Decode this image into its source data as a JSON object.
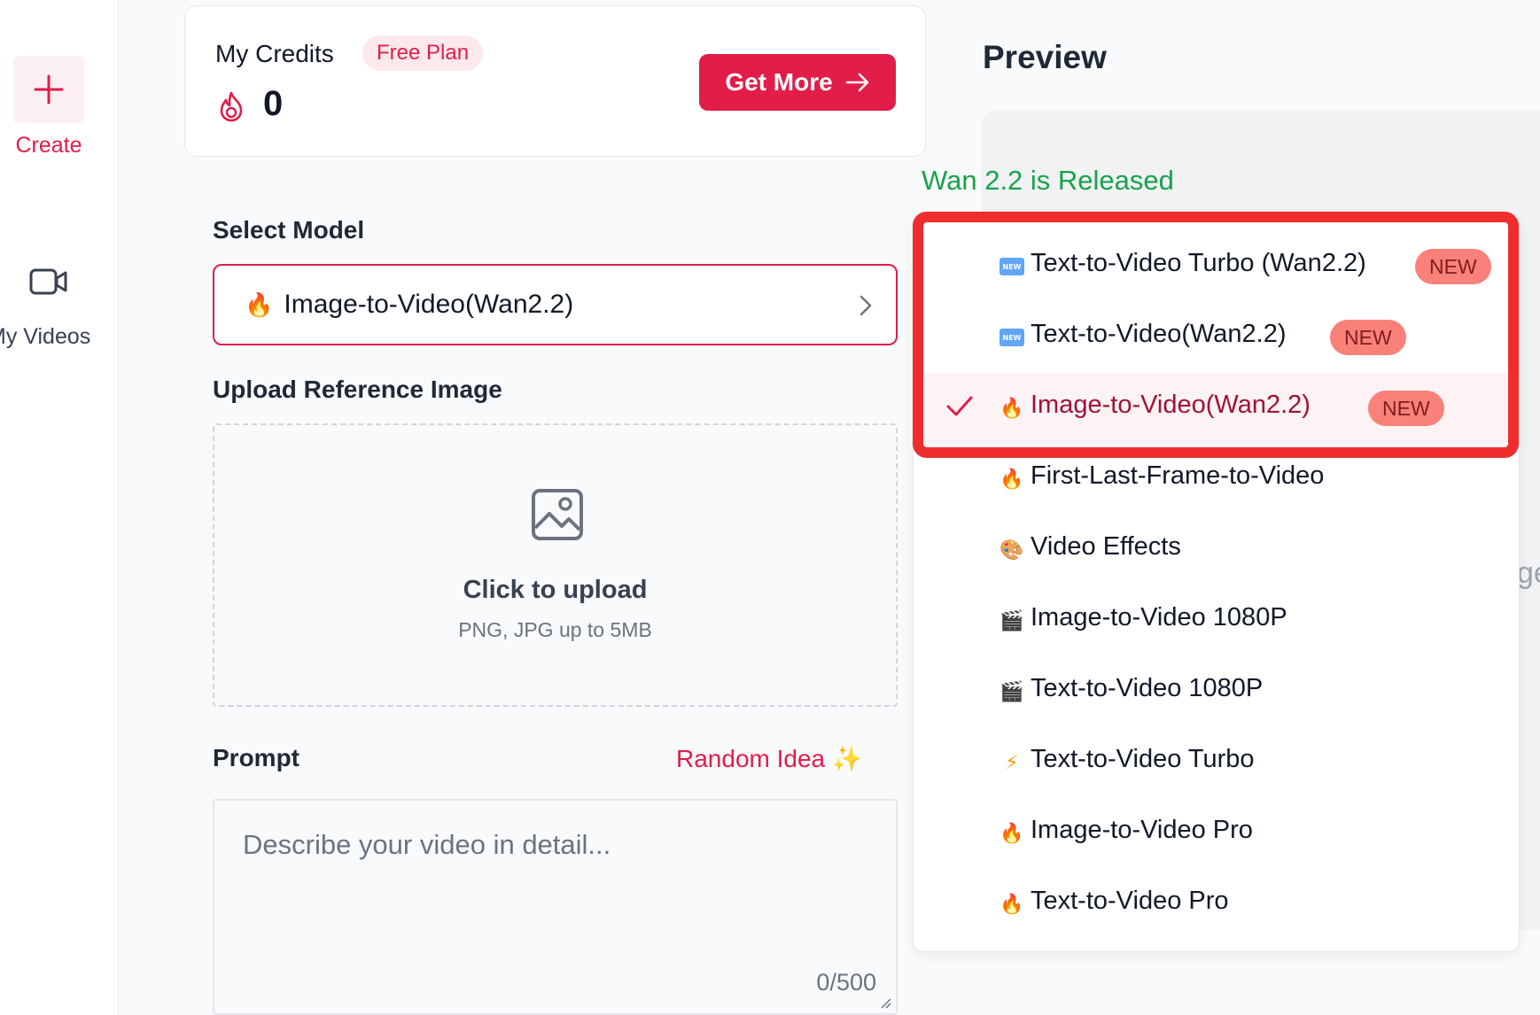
{
  "sidebar": {
    "create_label": "Create",
    "videos_label": "My Videos"
  },
  "credits": {
    "title": "My Credits",
    "plan": "Free Plan",
    "value": "0",
    "get_more_label": "Get More"
  },
  "form": {
    "select_model_label": "Select Model",
    "selected_model": "Image-to-Video(Wan2.2)",
    "upload_label": "Upload Reference Image",
    "upload_title": "Click to upload",
    "upload_sub": "PNG, JPG up to 5MB",
    "prompt_label": "Prompt",
    "random_idea": "Random Idea",
    "prompt_placeholder": "Describe your video in detail...",
    "prompt_count": "0/500"
  },
  "preview": {
    "title": "Preview",
    "cut_text": "ge"
  },
  "dropdown": {
    "release_note": "Wan 2.2 is Released",
    "badge_text": "NEW",
    "items": [
      {
        "label": "Text-to-Video Turbo (Wan2.2)",
        "icon": "new-tag-icon",
        "new": true,
        "selected": false
      },
      {
        "label": "Text-to-Video(Wan2.2)",
        "icon": "new-tag-icon",
        "new": true,
        "selected": false
      },
      {
        "label": "Image-to-Video(Wan2.2)",
        "icon": "fire-icon",
        "new": true,
        "selected": true
      },
      {
        "label": "First-Last-Frame-to-Video",
        "icon": "fire-icon",
        "new": false,
        "selected": false
      },
      {
        "label": "Video Effects",
        "icon": "palette-icon",
        "new": false,
        "selected": false
      },
      {
        "label": "Image-to-Video 1080P",
        "icon": "clapper-icon",
        "new": false,
        "selected": false
      },
      {
        "label": "Text-to-Video 1080P",
        "icon": "clapper-icon",
        "new": false,
        "selected": false
      },
      {
        "label": "Text-to-Video Turbo",
        "icon": "lightning-icon",
        "new": false,
        "selected": false
      },
      {
        "label": "Image-to-Video Pro",
        "icon": "fire-icon",
        "new": false,
        "selected": false
      },
      {
        "label": "Text-to-Video Pro",
        "icon": "fire-icon",
        "new": false,
        "selected": false
      }
    ]
  },
  "colors": {
    "accent": "#e11d48",
    "highlight": "#ef2d2d",
    "release_green": "#16a34a"
  }
}
